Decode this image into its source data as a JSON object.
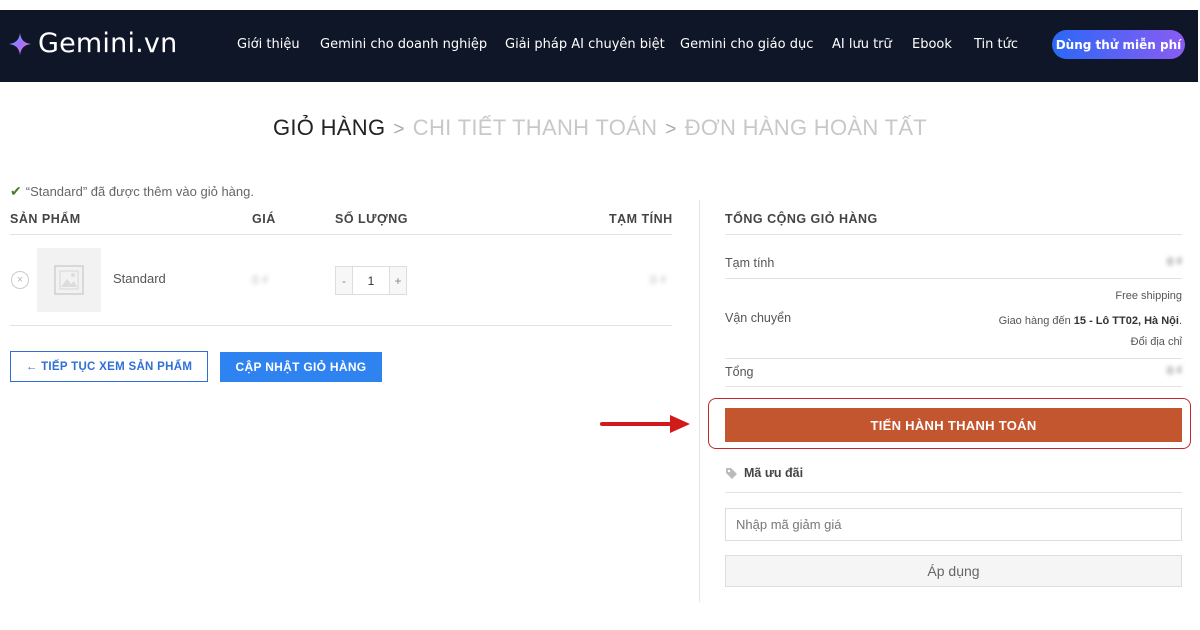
{
  "header": {
    "logo_text": "Gemini.vn",
    "nav": [
      "Giới thiệu",
      "Gemini cho doanh nghiệp",
      "Giải pháp AI chuyên biệt",
      "Gemini cho giáo dục",
      "AI lưu trữ",
      "Ebook",
      "Tin tức"
    ],
    "cta_label": "Dùng thử miễn phí",
    "colors": {
      "bar": "#0f1628",
      "cta_start": "#2b68f5",
      "cta_end": "#8a5cf3"
    }
  },
  "steps": {
    "cart": "GIỎ HÀNG",
    "separator": ">",
    "checkout": "CHI TIẾT THANH TOÁN",
    "complete": "ĐƠN HÀNG HOÀN TẤT"
  },
  "notice": "“Standard” đã được thêm vào giỏ hàng.",
  "cart": {
    "headers": {
      "product": "SẢN PHẨM",
      "price": "GIÁ",
      "qty": "SỐ LƯỢNG",
      "subtotal": "TẠM TÍNH"
    },
    "item": {
      "remove_icon": "×",
      "name": "Standard",
      "price": "0 ₫",
      "qty": "1",
      "minus": "-",
      "plus": "+",
      "subtotal": "0 ₫"
    },
    "continue_label": "← TIẾP TỤC XEM SẢN PHẨM",
    "update_label": "CẬP NHẬT GIỎ HÀNG"
  },
  "totals": {
    "title": "TỔNG CỘNG GIỎ HÀNG",
    "subtotal_label": "Tạm tính",
    "subtotal_value": "0 ₫",
    "shipping_label": "Vận chuyển",
    "shipping_method": "Free shipping",
    "shipping_prefix": "Giao hàng đến",
    "shipping_address": "15 - Lô TT02, Hà Nội",
    "change_address": "Đổi địa chỉ",
    "total_label": "Tổng",
    "total_value": "0 ₫",
    "checkout_label": "TIẾN HÀNH THANH TOÁN",
    "colors": {
      "checkout": "#c4562f",
      "highlight": "#c0262c"
    }
  },
  "coupon": {
    "label": "Mã ưu đãi",
    "placeholder": "Nhập mã giảm giá",
    "apply_label": "Áp dụng"
  }
}
